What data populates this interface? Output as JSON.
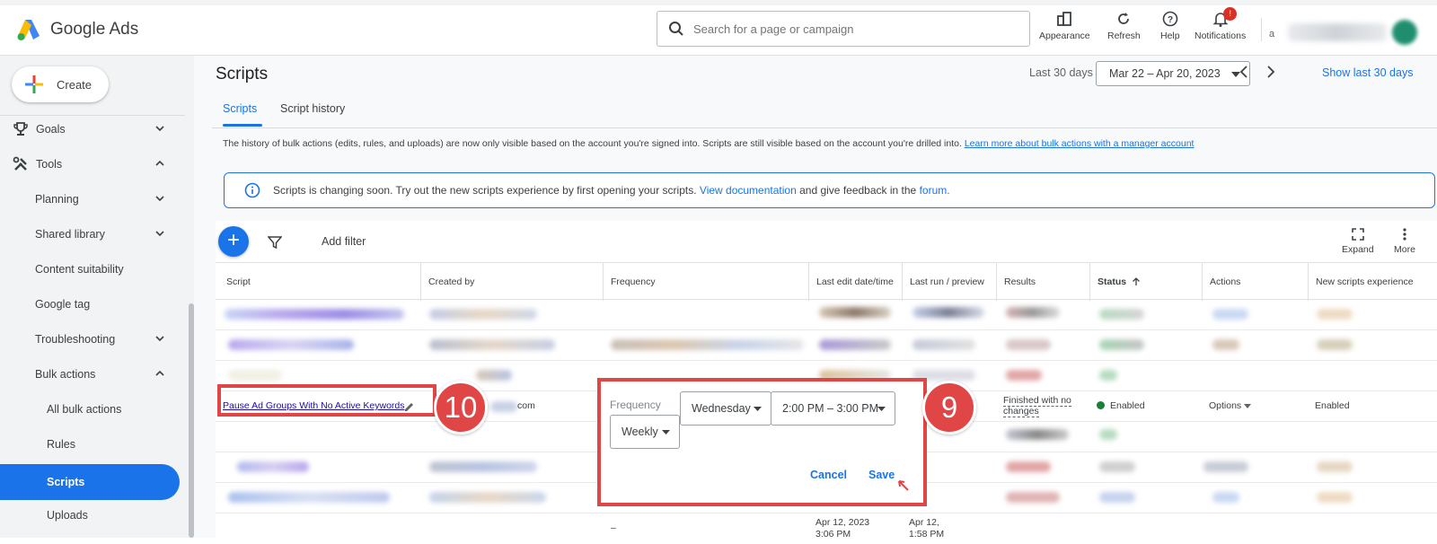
{
  "header": {
    "brand": "Google Ads",
    "search_placeholder": "Search for a page or campaign",
    "appearance": "Appearance",
    "refresh": "Refresh",
    "help": "Help",
    "notifications": "Notifications",
    "notification_count": "!",
    "account_initial": "a"
  },
  "sidebar": {
    "create": "Create",
    "goals": "Goals",
    "tools": "Tools",
    "planning": "Planning",
    "shared_library": "Shared library",
    "content_suitability": "Content suitability",
    "google_tag": "Google tag",
    "troubleshooting": "Troubleshooting",
    "bulk_actions": "Bulk actions",
    "all_bulk_actions": "All bulk actions",
    "rules": "Rules",
    "scripts": "Scripts",
    "uploads": "Uploads"
  },
  "page": {
    "title": "Scripts",
    "date_label": "Last 30 days",
    "date_range": "Mar 22 – Apr 20, 2023",
    "show_last": "Show last 30 days",
    "tabs": [
      "Scripts",
      "Script history"
    ],
    "note": "The history of bulk actions (edits, rules, and uploads) are now only visible based on the account you're signed into. Scripts are still visible based on the account you're drilled into.",
    "note_link": "Learn more about bulk actions with a manager account",
    "banner_text_1": "Scripts is changing soon. Try out the new scripts experience by first opening your scripts.",
    "banner_link_1": "View documentation",
    "banner_text_2": "and give feedback in the",
    "banner_link_2": "forum."
  },
  "toolbar": {
    "add_filter": "Add filter",
    "expand": "Expand",
    "more": "More"
  },
  "table": {
    "columns": [
      "Script",
      "Created by",
      "Frequency",
      "Last edit date/time",
      "Last run / preview",
      "Results",
      "Status",
      "Actions",
      "New scripts experience"
    ],
    "highlight_row": {
      "script": "Pause Ad Groups With No Active Keywords",
      "created_by_suffix": "com",
      "results": "Finished with no changes",
      "status": "Enabled",
      "actions": "Options",
      "new_exp": "Enabled"
    },
    "bottom_row": {
      "frequency": "–",
      "last_edit": "Apr 12, 2023",
      "last_edit_time": "3:06 PM",
      "last_run": "Apr 12,",
      "last_run_time": "1:58 PM"
    }
  },
  "popup": {
    "label": "Frequency",
    "frequency": "Weekly",
    "day": "Wednesday",
    "time": "2:00 PM – 3:00 PM",
    "cancel": "Cancel",
    "save": "Save"
  },
  "annotations": {
    "step_left": "10",
    "step_right": "9",
    "highlight_color": "#e04646"
  },
  "colors": {
    "accent": "#1a73e8",
    "enabled_green": "#188038"
  }
}
